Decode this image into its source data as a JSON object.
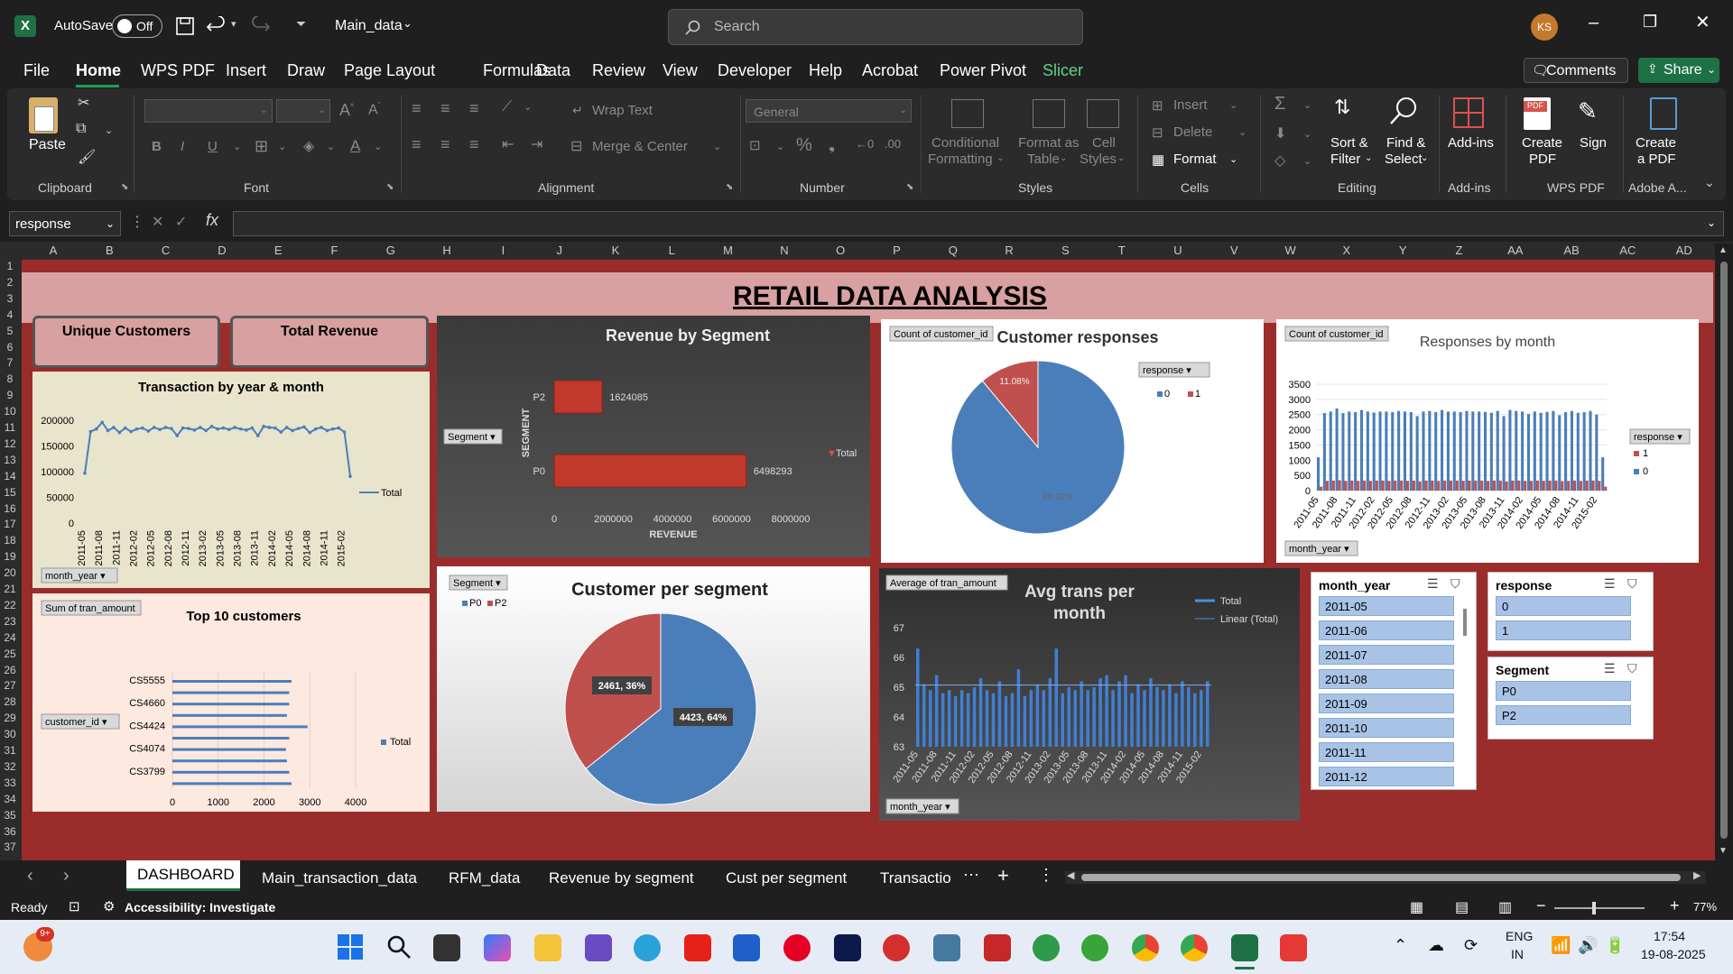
{
  "titlebar": {
    "autosave_label": "AutoSave",
    "toggle_state": "Off",
    "filename": "Main_data",
    "search_placeholder": "Search",
    "user_initials": "KS"
  },
  "menu": [
    "File",
    "Home",
    "WPS PDF",
    "Insert",
    "Draw",
    "Page Layout",
    "Formulas",
    "Data",
    "Review",
    "View",
    "Developer",
    "Help",
    "Acrobat",
    "Power Pivot",
    "Slicer"
  ],
  "menu_buttons": {
    "comments": "Comments",
    "share": "Share"
  },
  "ribbon": {
    "clipboard": {
      "paste": "Paste",
      "group": "Clipboard"
    },
    "font": {
      "group": "Font"
    },
    "alignment": {
      "wrap": "Wrap Text",
      "merge": "Merge & Center",
      "group": "Alignment"
    },
    "number": {
      "format": "General",
      "group": "Number"
    },
    "styles": {
      "cond_line1": "Conditional",
      "cond_line2": "Formatting",
      "fmt_line1": "Format as",
      "fmt_line2": "Table",
      "cell_line1": "Cell",
      "cell_line2": "Styles",
      "group": "Styles"
    },
    "cells": {
      "insert": "Insert",
      "delete": "Delete",
      "format": "Format",
      "group": "Cells"
    },
    "editing": {
      "sort_line1": "Sort &",
      "sort_line2": "Filter",
      "find_line1": "Find &",
      "find_line2": "Select",
      "group": "Editing"
    },
    "addins": {
      "label": "Add-ins",
      "group": "Add-ins"
    },
    "wpspdf": {
      "create_line1": "Create",
      "create_line2": "PDF",
      "sign": "Sign",
      "group": "WPS PDF"
    },
    "adobe": {
      "line1": "Create",
      "line2": "a PDF",
      "group": "Adobe A..."
    }
  },
  "formula_bar": {
    "name_box": "response",
    "fx": "fx",
    "content": ""
  },
  "columns": [
    "A",
    "B",
    "C",
    "D",
    "E",
    "F",
    "G",
    "H",
    "I",
    "J",
    "K",
    "L",
    "M",
    "N",
    "O",
    "P",
    "Q",
    "R",
    "S",
    "T",
    "U",
    "V",
    "W",
    "X",
    "Y",
    "Z",
    "AA",
    "AB",
    "AC",
    "AD"
  ],
  "rows": [
    "1",
    "2",
    "3",
    "4",
    "5",
    "6",
    "7",
    "8",
    "9",
    "10",
    "11",
    "12",
    "13",
    "14",
    "15",
    "16",
    "17",
    "18",
    "19",
    "20",
    "21",
    "22",
    "23",
    "24",
    "25",
    "26",
    "27",
    "28",
    "29",
    "30",
    "31",
    "32",
    "33",
    "34",
    "35",
    "36",
    "37"
  ],
  "dashboard": {
    "title": "RETAIL DATA ANALYSIS",
    "kpi1": "Unique Customers",
    "kpi2": "Total Revenue"
  },
  "colors": {
    "sheet_bg": "#9b2c2c",
    "header_band": "#d8a0a0",
    "blue": "#4a7ebb",
    "red": "#c0504d",
    "excel_green": "#1e7145"
  },
  "chart_data": [
    {
      "id": "txn",
      "type": "line",
      "title": "Transaction by year & month",
      "field_button": "month_year",
      "legend": "Total",
      "ylim": [
        0,
        200000
      ],
      "yticks": [
        "200000",
        "150000",
        "100000",
        "50000",
        "0"
      ],
      "x": [
        "2011-05",
        "2011-06",
        "2011-07",
        "2011-08",
        "2011-09",
        "2011-10",
        "2011-11",
        "2011-12",
        "2012-01",
        "2012-02",
        "2012-03",
        "2012-04",
        "2012-05",
        "2012-06",
        "2012-07",
        "2012-08",
        "2012-09",
        "2012-10",
        "2012-11",
        "2012-12",
        "2013-01",
        "2013-02",
        "2013-03",
        "2013-04",
        "2013-05",
        "2013-06",
        "2013-07",
        "2013-08",
        "2013-09",
        "2013-10",
        "2013-11",
        "2013-12",
        "2014-01",
        "2014-02",
        "2014-03",
        "2014-04",
        "2014-05",
        "2014-06",
        "2014-07",
        "2014-08",
        "2014-09",
        "2014-10",
        "2014-11",
        "2014-12",
        "2015-01",
        "2015-02",
        "2015-03"
      ],
      "xlabels": [
        "2011-05",
        "2011-08",
        "2011-11",
        "2012-02",
        "2012-05",
        "2012-08",
        "2012-11",
        "2013-02",
        "2013-05",
        "2013-08",
        "2013-11",
        "2014-02",
        "2014-05",
        "2014-08",
        "2014-11",
        "2015-02"
      ],
      "values": [
        97000,
        178000,
        183000,
        196000,
        180000,
        186000,
        176000,
        185000,
        178000,
        183000,
        185000,
        179000,
        186000,
        182000,
        186000,
        184000,
        170000,
        185000,
        184000,
        181000,
        186000,
        180000,
        188000,
        183000,
        185000,
        182000,
        186000,
        183000,
        181000,
        185000,
        170000,
        188000,
        186000,
        185000,
        177000,
        186000,
        180000,
        184000,
        187000,
        176000,
        183000,
        186000,
        180000,
        183000,
        185000,
        177000,
        91000
      ]
    },
    {
      "id": "seg_rev",
      "type": "bar",
      "title": "Revenue by Segment",
      "field_button": "Segment",
      "ylabel": "SEGMENT",
      "xlabel": "REVENUE",
      "legend": "Total",
      "categories": [
        "P2",
        "P0"
      ],
      "values": [
        1624085,
        6498293
      ],
      "xlim": [
        0,
        8000000
      ],
      "xticks": [
        "0",
        "2000000",
        "4000000",
        "6000000",
        "8000000"
      ]
    },
    {
      "id": "responses",
      "type": "pie",
      "title": "Customer responses",
      "field_button": "Count of customer_id",
      "filter_button": "response",
      "legend": [
        "0",
        "1"
      ],
      "values": [
        88.92,
        11.08
      ],
      "labels": [
        "88.92%",
        "11.08%"
      ]
    },
    {
      "id": "resp_month",
      "type": "bar",
      "title": "Responses by month",
      "field_button": "Count of customer_id",
      "filter_button": "response",
      "axis_button": "month_year",
      "legend": [
        "1",
        "0"
      ],
      "ylim": [
        0,
        3500
      ],
      "yticks": [
        "3500",
        "3000",
        "2500",
        "2000",
        "1500",
        "1000",
        "500",
        "0"
      ],
      "xlabels": [
        "2011-05",
        "2011-08",
        "2011-11",
        "2012-02",
        "2012-05",
        "2012-08",
        "2012-11",
        "2013-02",
        "2013-05",
        "2013-08",
        "2013-11",
        "2014-02",
        "2014-05",
        "2014-08",
        "2014-11",
        "2015-02"
      ],
      "series": [
        {
          "name": "0",
          "values": [
            1100,
            2550,
            2600,
            2700,
            2550,
            2600,
            2580,
            2650,
            2600,
            2570,
            2600,
            2600,
            2580,
            2620,
            2600,
            2580,
            2450,
            2600,
            2620,
            2580,
            2650,
            2600,
            2600,
            2580,
            2620,
            2600,
            2600,
            2590,
            2560,
            2620,
            2450,
            2650,
            2620,
            2600,
            2520,
            2600,
            2560,
            2590,
            2620,
            2480,
            2580,
            2620,
            2560,
            2580,
            2620,
            2500,
            1100
          ]
        },
        {
          "name": "1",
          "values": [
            130,
            320,
            330,
            340,
            320,
            330,
            320,
            330,
            320,
            330,
            330,
            320,
            330,
            330,
            320,
            330,
            300,
            330,
            330,
            320,
            330,
            330,
            330,
            320,
            330,
            330,
            330,
            320,
            330,
            330,
            300,
            330,
            330,
            320,
            320,
            330,
            320,
            330,
            330,
            310,
            320,
            330,
            320,
            330,
            330,
            320,
            130
          ]
        }
      ]
    },
    {
      "id": "top10",
      "type": "bar",
      "title": "Top 10 customers",
      "field_button": "Sum of tran_amount",
      "axis_button": "customer_id",
      "legend": "Total",
      "categories": [
        "CS5555",
        "",
        "CS4660",
        "",
        "CS4424",
        "",
        "CS4074",
        "",
        "CS3799",
        ""
      ],
      "values": [
        2600,
        2550,
        2550,
        2500,
        2950,
        2550,
        2480,
        2500,
        2550,
        2600
      ],
      "xlim": [
        0,
        4000
      ],
      "xticks": [
        "0",
        "1000",
        "2000",
        "3000",
        "4000"
      ]
    },
    {
      "id": "cust_seg",
      "type": "pie",
      "title": "Customer per segment",
      "field_button": "Segment",
      "legend": [
        "P0",
        "P2"
      ],
      "values": [
        4423,
        2461
      ],
      "labels": [
        "4423, 64%",
        "2461, 36%"
      ]
    },
    {
      "id": "avg_trans",
      "type": "bar",
      "title_line1": "Avg trans per",
      "title_line2": "month",
      "field_button": "Average of tran_amount",
      "axis_button": "month_year",
      "legend": [
        "Total",
        "Linear (Total)"
      ],
      "ylim": [
        63,
        67
      ],
      "yticks": [
        "67",
        "66",
        "65",
        "64",
        "63"
      ],
      "xlabels": [
        "2011-05",
        "2011-08",
        "2011-11",
        "2012-02",
        "2012-05",
        "2012-08",
        "2012-11",
        "2013-02",
        "2013-05",
        "2013-08",
        "2013-11",
        "2014-02",
        "2014-05",
        "2014-08",
        "2014-11",
        "2015-02"
      ],
      "values": [
        66.3,
        65.1,
        64.9,
        65.4,
        64.8,
        64.9,
        64.7,
        64.9,
        64.8,
        65.0,
        65.3,
        64.9,
        64.8,
        65.2,
        64.7,
        64.8,
        65.6,
        64.7,
        64.9,
        65.1,
        64.9,
        65.3,
        66.3,
        64.8,
        65.0,
        64.9,
        65.2,
        64.9,
        65.0,
        65.3,
        65.4,
        64.9,
        65.2,
        65.4,
        64.8,
        65.1,
        64.9,
        65.3,
        65.0,
        64.9,
        65.1,
        64.8,
        65.2,
        65.0,
        64.8,
        64.9,
        65.2
      ]
    }
  ],
  "slicers": {
    "month_year": {
      "title": "month_year",
      "items": [
        "2011-05",
        "2011-06",
        "2011-07",
        "2011-08",
        "2011-09",
        "2011-10",
        "2011-11",
        "2011-12"
      ]
    },
    "response": {
      "title": "response",
      "items": [
        "0",
        "1"
      ]
    },
    "segment": {
      "title": "Segment",
      "items": [
        "P0",
        "P2"
      ]
    }
  },
  "tabs": [
    "DASHBOARD",
    "Main_transaction_data",
    "RFM_data",
    "Revenue by segment",
    "Cust per segment",
    "Transactio"
  ],
  "status": {
    "ready": "Ready",
    "accessibility": "Accessibility: Investigate",
    "zoom": "77%"
  },
  "taskbar": {
    "lang1": "ENG",
    "lang2": "IN",
    "time": "17:54",
    "date": "19-08-2025",
    "badge": "9+"
  }
}
